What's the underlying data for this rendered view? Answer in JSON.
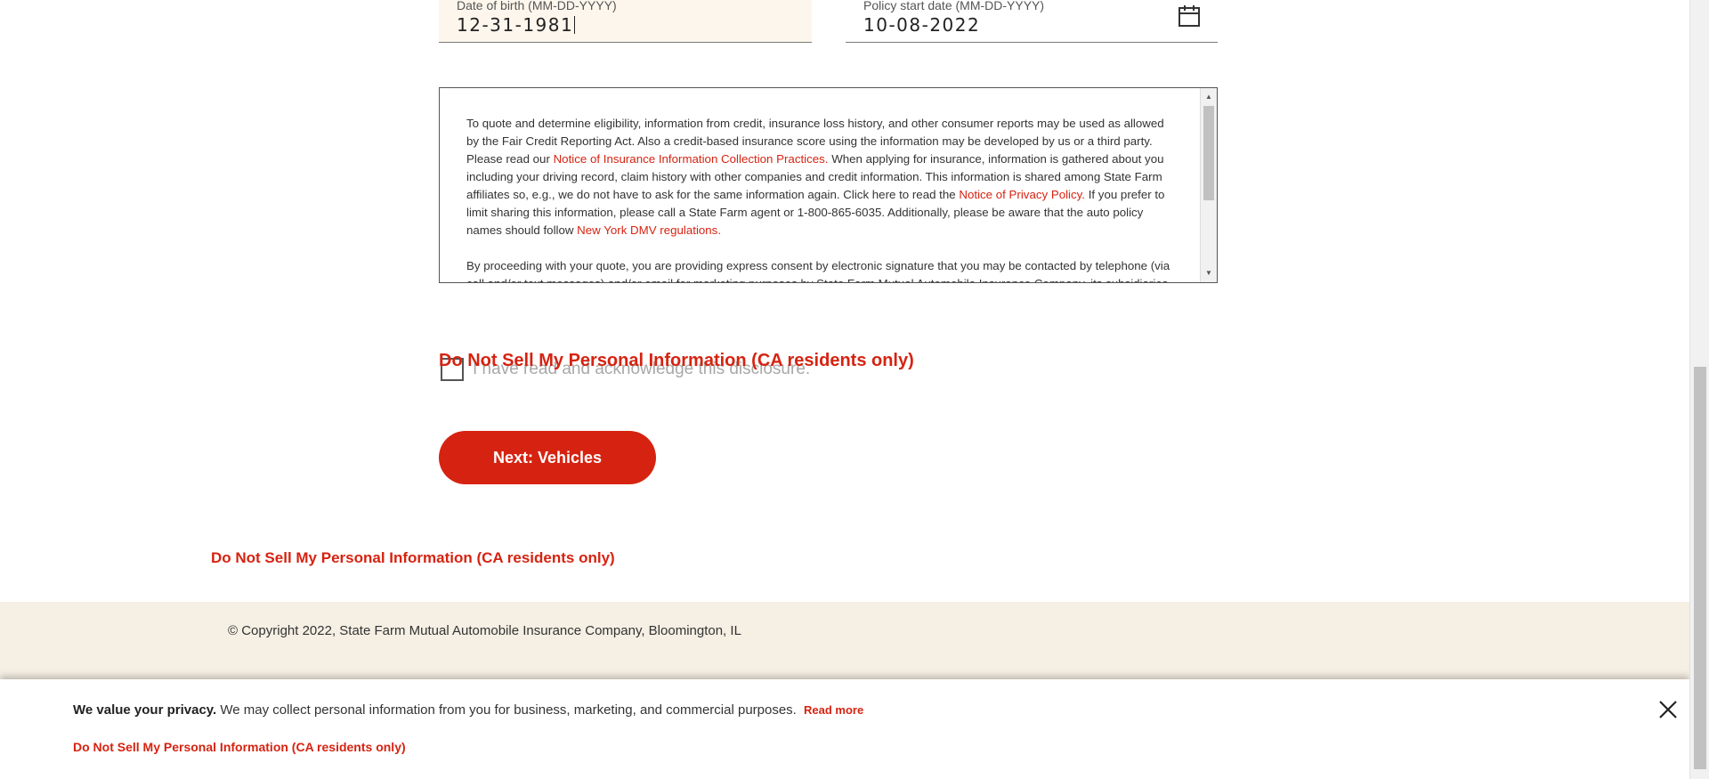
{
  "form": {
    "dob": {
      "label": "Date of birth (MM-DD-YYYY)",
      "value": "12-31-1981"
    },
    "policy_start": {
      "label": "Policy start date (MM-DD-YYYY)",
      "value": "10-08-2022",
      "icon": "calendar-icon"
    }
  },
  "disclosure": {
    "p1_a": "To quote and determine eligibility, information from credit, insurance loss history, and other consumer reports may be used as allowed by the Fair Credit Reporting Act. Also a credit-based insurance score using the information may be developed by us or a third party. Please read our ",
    "link_collection": "Notice of Insurance Information Collection Practices.",
    "p1_b": " When applying for insurance, information is gathered about you including your driving record, claim history with other companies and credit information. This information is shared among State Farm affiliates so, e.g., we do not have to ask for the same information again. Click here to read the ",
    "link_privacy": "Notice of Privacy Policy.",
    "p1_c": " If you prefer to limit sharing this information, please call a State Farm agent or 1-800-865-6035. Additionally, please be aware that the auto policy names should follow ",
    "link_dmv": "New York DMV regulations.",
    "p2": "By proceeding with your quote, you are providing express consent by electronic signature that you may be contacted by telephone (via call and/or text messages) and/or email for marketing purposes by State Farm Mutual Automobile Insurance Company, its subsidiaries and"
  },
  "acknowledge": {
    "label": "I have read and acknowledge this disclosure."
  },
  "do_not_sell": "Do Not Sell My Personal Information (CA residents only)",
  "next_button": "Next: Vehicles",
  "footer": {
    "copyright": "© Copyright 2022, State Farm Mutual Automobile Insurance Company, Bloomington, IL"
  },
  "privacy_banner": {
    "lead": "We value your privacy.",
    "text": " We may collect personal information from you for business, marketing, and commercial purposes.",
    "read_more": "Read more",
    "do_not_sell": "Do Not Sell My Personal Information (CA residents only)"
  },
  "colors": {
    "accent": "#d62311",
    "footer_bg": "#f5efe4",
    "dob_bg": "#fdf6ec"
  }
}
